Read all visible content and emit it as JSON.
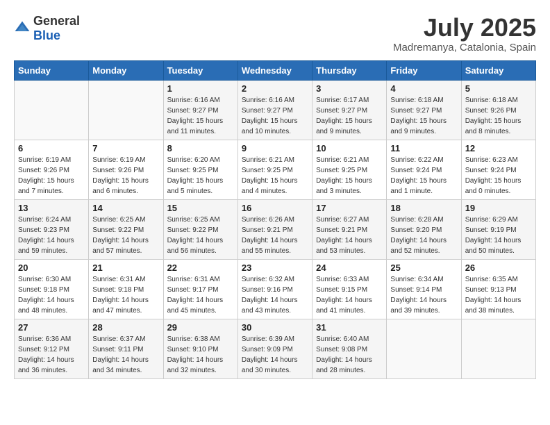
{
  "header": {
    "logo_general": "General",
    "logo_blue": "Blue",
    "month": "July 2025",
    "location": "Madremanya, Catalonia, Spain"
  },
  "weekdays": [
    "Sunday",
    "Monday",
    "Tuesday",
    "Wednesday",
    "Thursday",
    "Friday",
    "Saturday"
  ],
  "weeks": [
    [
      {
        "day": "",
        "sunrise": "",
        "sunset": "",
        "daylight": ""
      },
      {
        "day": "",
        "sunrise": "",
        "sunset": "",
        "daylight": ""
      },
      {
        "day": "1",
        "sunrise": "Sunrise: 6:16 AM",
        "sunset": "Sunset: 9:27 PM",
        "daylight": "Daylight: 15 hours and 11 minutes."
      },
      {
        "day": "2",
        "sunrise": "Sunrise: 6:16 AM",
        "sunset": "Sunset: 9:27 PM",
        "daylight": "Daylight: 15 hours and 10 minutes."
      },
      {
        "day": "3",
        "sunrise": "Sunrise: 6:17 AM",
        "sunset": "Sunset: 9:27 PM",
        "daylight": "Daylight: 15 hours and 9 minutes."
      },
      {
        "day": "4",
        "sunrise": "Sunrise: 6:18 AM",
        "sunset": "Sunset: 9:27 PM",
        "daylight": "Daylight: 15 hours and 9 minutes."
      },
      {
        "day": "5",
        "sunrise": "Sunrise: 6:18 AM",
        "sunset": "Sunset: 9:26 PM",
        "daylight": "Daylight: 15 hours and 8 minutes."
      }
    ],
    [
      {
        "day": "6",
        "sunrise": "Sunrise: 6:19 AM",
        "sunset": "Sunset: 9:26 PM",
        "daylight": "Daylight: 15 hours and 7 minutes."
      },
      {
        "day": "7",
        "sunrise": "Sunrise: 6:19 AM",
        "sunset": "Sunset: 9:26 PM",
        "daylight": "Daylight: 15 hours and 6 minutes."
      },
      {
        "day": "8",
        "sunrise": "Sunrise: 6:20 AM",
        "sunset": "Sunset: 9:25 PM",
        "daylight": "Daylight: 15 hours and 5 minutes."
      },
      {
        "day": "9",
        "sunrise": "Sunrise: 6:21 AM",
        "sunset": "Sunset: 9:25 PM",
        "daylight": "Daylight: 15 hours and 4 minutes."
      },
      {
        "day": "10",
        "sunrise": "Sunrise: 6:21 AM",
        "sunset": "Sunset: 9:25 PM",
        "daylight": "Daylight: 15 hours and 3 minutes."
      },
      {
        "day": "11",
        "sunrise": "Sunrise: 6:22 AM",
        "sunset": "Sunset: 9:24 PM",
        "daylight": "Daylight: 15 hours and 1 minute."
      },
      {
        "day": "12",
        "sunrise": "Sunrise: 6:23 AM",
        "sunset": "Sunset: 9:24 PM",
        "daylight": "Daylight: 15 hours and 0 minutes."
      }
    ],
    [
      {
        "day": "13",
        "sunrise": "Sunrise: 6:24 AM",
        "sunset": "Sunset: 9:23 PM",
        "daylight": "Daylight: 14 hours and 59 minutes."
      },
      {
        "day": "14",
        "sunrise": "Sunrise: 6:25 AM",
        "sunset": "Sunset: 9:22 PM",
        "daylight": "Daylight: 14 hours and 57 minutes."
      },
      {
        "day": "15",
        "sunrise": "Sunrise: 6:25 AM",
        "sunset": "Sunset: 9:22 PM",
        "daylight": "Daylight: 14 hours and 56 minutes."
      },
      {
        "day": "16",
        "sunrise": "Sunrise: 6:26 AM",
        "sunset": "Sunset: 9:21 PM",
        "daylight": "Daylight: 14 hours and 55 minutes."
      },
      {
        "day": "17",
        "sunrise": "Sunrise: 6:27 AM",
        "sunset": "Sunset: 9:21 PM",
        "daylight": "Daylight: 14 hours and 53 minutes."
      },
      {
        "day": "18",
        "sunrise": "Sunrise: 6:28 AM",
        "sunset": "Sunset: 9:20 PM",
        "daylight": "Daylight: 14 hours and 52 minutes."
      },
      {
        "day": "19",
        "sunrise": "Sunrise: 6:29 AM",
        "sunset": "Sunset: 9:19 PM",
        "daylight": "Daylight: 14 hours and 50 minutes."
      }
    ],
    [
      {
        "day": "20",
        "sunrise": "Sunrise: 6:30 AM",
        "sunset": "Sunset: 9:18 PM",
        "daylight": "Daylight: 14 hours and 48 minutes."
      },
      {
        "day": "21",
        "sunrise": "Sunrise: 6:31 AM",
        "sunset": "Sunset: 9:18 PM",
        "daylight": "Daylight: 14 hours and 47 minutes."
      },
      {
        "day": "22",
        "sunrise": "Sunrise: 6:31 AM",
        "sunset": "Sunset: 9:17 PM",
        "daylight": "Daylight: 14 hours and 45 minutes."
      },
      {
        "day": "23",
        "sunrise": "Sunrise: 6:32 AM",
        "sunset": "Sunset: 9:16 PM",
        "daylight": "Daylight: 14 hours and 43 minutes."
      },
      {
        "day": "24",
        "sunrise": "Sunrise: 6:33 AM",
        "sunset": "Sunset: 9:15 PM",
        "daylight": "Daylight: 14 hours and 41 minutes."
      },
      {
        "day": "25",
        "sunrise": "Sunrise: 6:34 AM",
        "sunset": "Sunset: 9:14 PM",
        "daylight": "Daylight: 14 hours and 39 minutes."
      },
      {
        "day": "26",
        "sunrise": "Sunrise: 6:35 AM",
        "sunset": "Sunset: 9:13 PM",
        "daylight": "Daylight: 14 hours and 38 minutes."
      }
    ],
    [
      {
        "day": "27",
        "sunrise": "Sunrise: 6:36 AM",
        "sunset": "Sunset: 9:12 PM",
        "daylight": "Daylight: 14 hours and 36 minutes."
      },
      {
        "day": "28",
        "sunrise": "Sunrise: 6:37 AM",
        "sunset": "Sunset: 9:11 PM",
        "daylight": "Daylight: 14 hours and 34 minutes."
      },
      {
        "day": "29",
        "sunrise": "Sunrise: 6:38 AM",
        "sunset": "Sunset: 9:10 PM",
        "daylight": "Daylight: 14 hours and 32 minutes."
      },
      {
        "day": "30",
        "sunrise": "Sunrise: 6:39 AM",
        "sunset": "Sunset: 9:09 PM",
        "daylight": "Daylight: 14 hours and 30 minutes."
      },
      {
        "day": "31",
        "sunrise": "Sunrise: 6:40 AM",
        "sunset": "Sunset: 9:08 PM",
        "daylight": "Daylight: 14 hours and 28 minutes."
      },
      {
        "day": "",
        "sunrise": "",
        "sunset": "",
        "daylight": ""
      },
      {
        "day": "",
        "sunrise": "",
        "sunset": "",
        "daylight": ""
      }
    ]
  ]
}
